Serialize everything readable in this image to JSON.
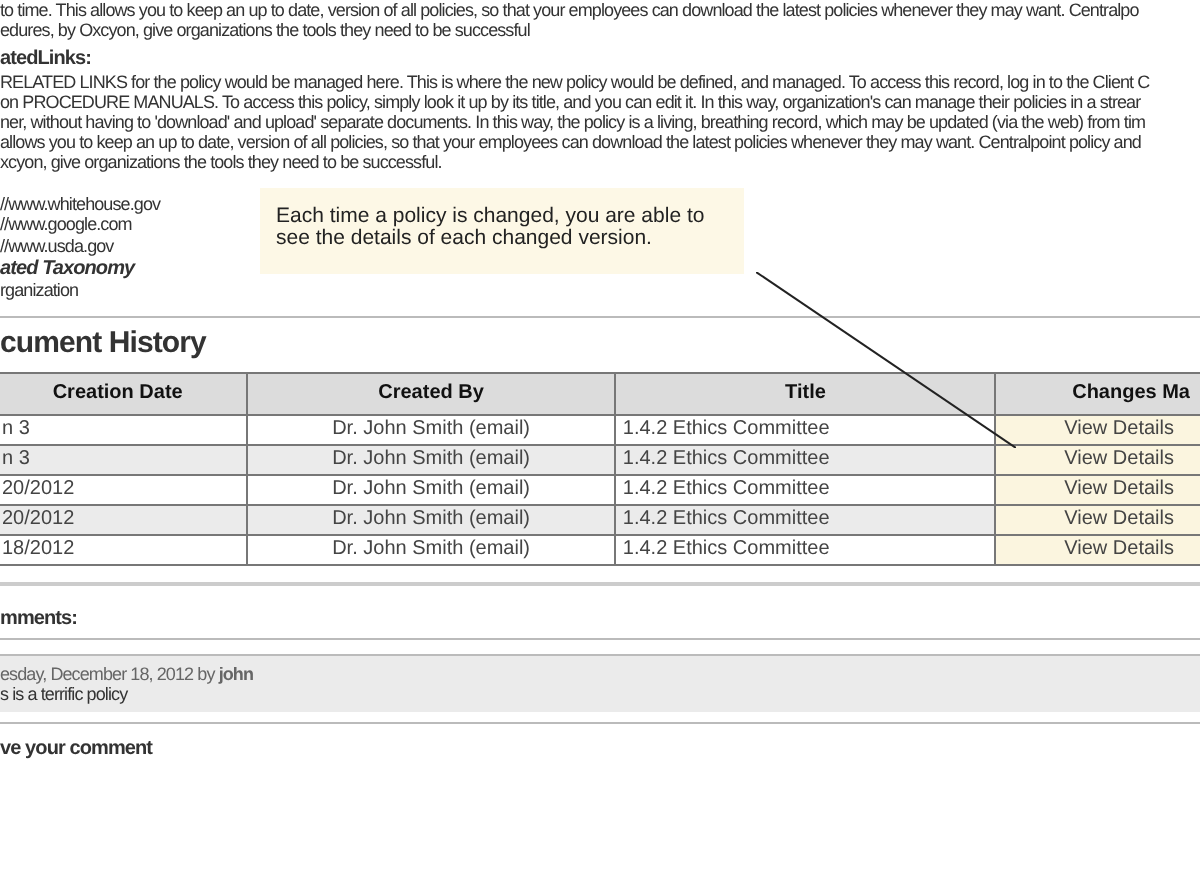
{
  "intro_lines": [
    "to time. This allows you to keep an up to date, version of all policies, so that your employees can download the latest policies whenever they may want. Centralpo",
    "edures, by Oxcyon, give organizations the tools they need to be successful"
  ],
  "related_links": {
    "heading": "atedLinks:",
    "lines": [
      "RELATED LINKS for the policy would be managed here. This is where the new policy would be defined, and managed. To access this record, log in to the Client C",
      "on PROCEDURE MANUALS. To access this policy, simply look it up by its title, and you can edit it. In this way, organization's can manage their policies in a strear",
      "ner, without having to 'download' and upload' separate documents. In this way, the policy is a living, breathing record, which may be updated (via the web) from tim",
      "allows you to keep an up to date, version of all policies, so that your employees can download the latest policies whenever they may want. Centralpoint policy and",
      "xcyon, give organizations the tools they need to be successful."
    ],
    "urls": [
      "//www.whitehouse.gov",
      "//www.google.com",
      "//www.usda.gov"
    ]
  },
  "taxonomy": {
    "heading": "ated Taxonomy",
    "value": "rganization"
  },
  "callout": {
    "text": "Each time a policy is changed, you are able to see the details of each changed version."
  },
  "document_history": {
    "heading": "cument History",
    "columns": [
      "Creation Date",
      "Created By",
      "Title",
      "Changes Ma"
    ],
    "rows": [
      {
        "date": "n 3",
        "created_by": "Dr. John Smith (email)",
        "title": "1.4.2 Ethics Committee",
        "changes": "View Details"
      },
      {
        "date": "n 3",
        "created_by": "Dr. John Smith (email)",
        "title": "1.4.2 Ethics Committee",
        "changes": "View Details"
      },
      {
        "date": "20/2012",
        "created_by": "Dr. John Smith (email)",
        "title": "1.4.2 Ethics Committee",
        "changes": "View Details"
      },
      {
        "date": "20/2012",
        "created_by": "Dr. John Smith (email)",
        "title": "1.4.2 Ethics Committee",
        "changes": "View Details"
      },
      {
        "date": "18/2012",
        "created_by": "Dr. John Smith (email)",
        "title": "1.4.2 Ethics Committee",
        "changes": "View Details"
      }
    ]
  },
  "comments": {
    "heading": "mments:",
    "items": [
      {
        "meta": "esday, December 18, 2012 by **john**",
        "text": "s is a terrific policy"
      }
    ],
    "leave_heading": "ve your comment"
  }
}
